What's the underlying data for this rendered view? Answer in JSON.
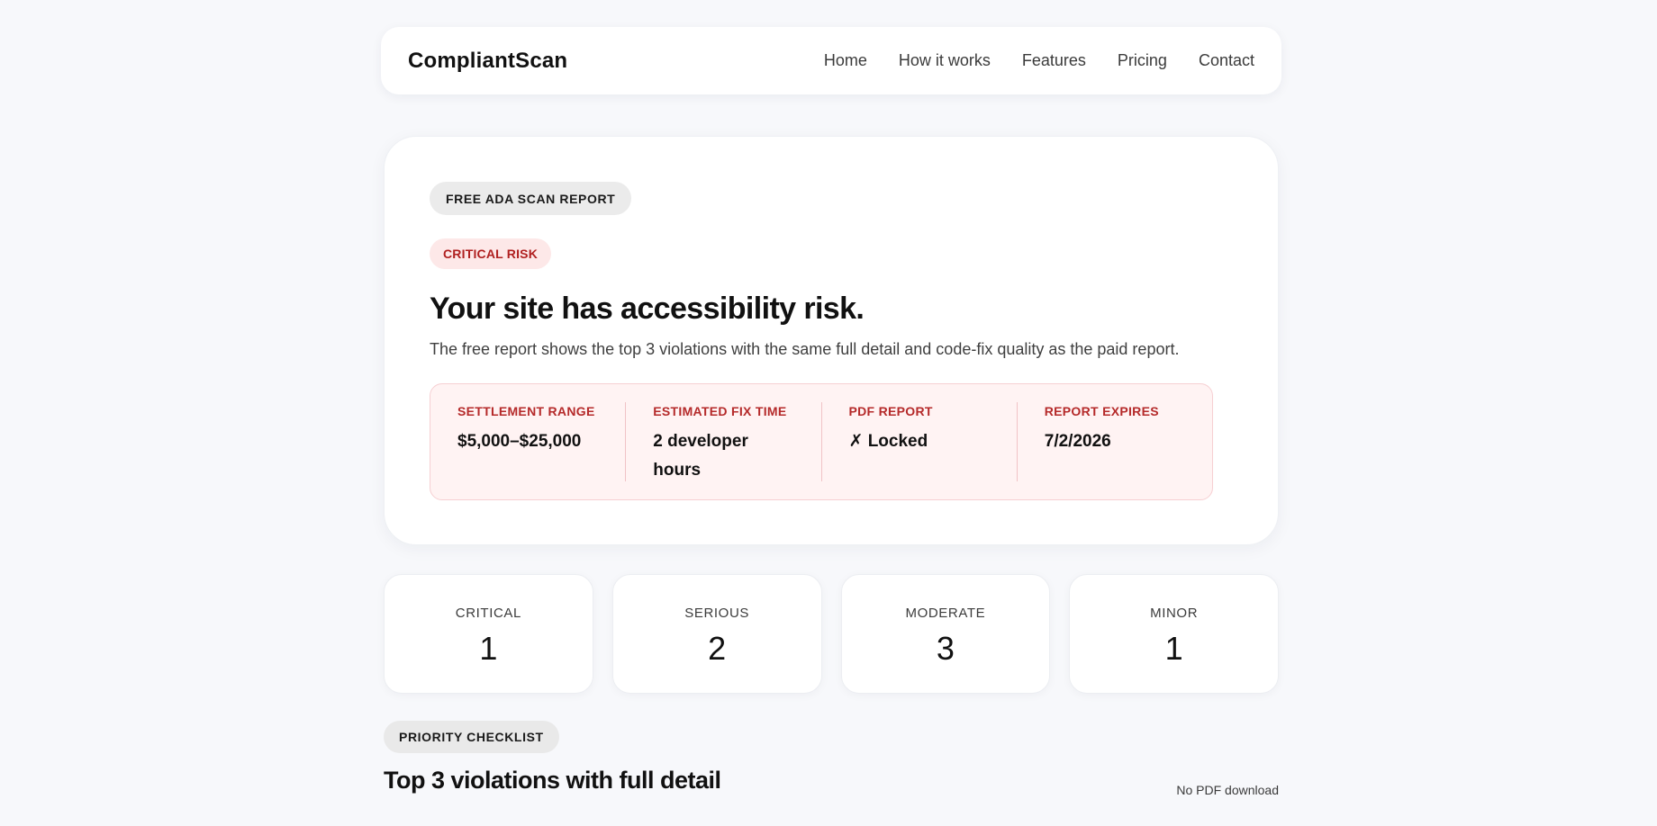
{
  "nav": {
    "brand": "CompliantScan",
    "links": [
      "Home",
      "How it works",
      "Features",
      "Pricing",
      "Contact"
    ]
  },
  "hero": {
    "report_badge": "FREE ADA SCAN REPORT",
    "risk_badge": "CRITICAL RISK",
    "title": "Your site has accessibility risk.",
    "subtitle": "The free report shows the top 3 violations with the same full detail and code-fix quality as the paid report.",
    "metrics": [
      {
        "label": "SETTLEMENT RANGE",
        "value": "$5,000–$25,000"
      },
      {
        "label": "ESTIMATED FIX TIME",
        "value": "2 developer hours"
      },
      {
        "label": "PDF REPORT",
        "value": "✗ Locked"
      },
      {
        "label": "REPORT EXPIRES",
        "value": "7/2/2026"
      }
    ]
  },
  "severity": [
    {
      "label": "CRITICAL",
      "count": "1"
    },
    {
      "label": "SERIOUS",
      "count": "2"
    },
    {
      "label": "MODERATE",
      "count": "3"
    },
    {
      "label": "MINOR",
      "count": "1"
    }
  ],
  "checklist": {
    "badge": "PRIORITY CHECKLIST",
    "title": "Top 3 violations with full detail",
    "note": "No PDF download"
  },
  "colors": {
    "accent_red": "#b52a2a",
    "risk_bg": "#fde8e8",
    "metrics_bg": "#fff3f3",
    "page_bg": "#f7f8fb"
  }
}
